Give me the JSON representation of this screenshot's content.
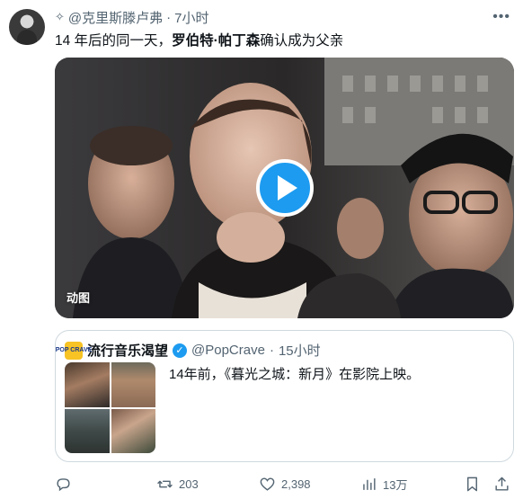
{
  "author": {
    "handle": "@克里斯滕卢弗",
    "time": "7小时",
    "spark_glyph": "✧"
  },
  "tweet": {
    "text_prefix": "14 年后的同一天，",
    "text_bold": "罗伯特·帕丁森",
    "text_suffix": "确认成为父亲"
  },
  "media": {
    "badge": "动图"
  },
  "quote": {
    "avatar_text": "POP CRAVE",
    "name": "流行音乐渴望",
    "handle": "@PopCrave",
    "separator": "·",
    "time": "15小时",
    "text": "14年前，《暮光之城：新月》在影院上映。"
  },
  "actions": {
    "retweets": "203",
    "views": "2,398",
    "views_time": "13万"
  },
  "colors": {
    "accent": "#1d9bf0",
    "muted_text": "#536471",
    "border": "#cfd9de"
  }
}
